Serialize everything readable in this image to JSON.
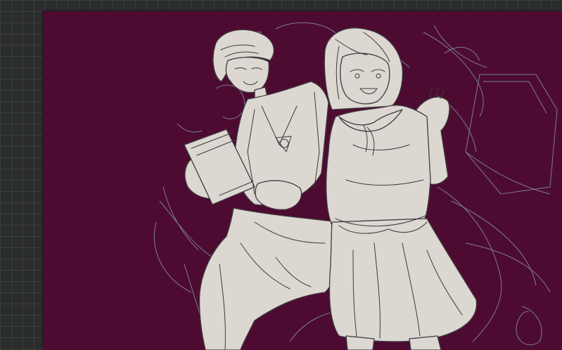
{
  "app": {
    "name": "drawing-canvas"
  },
  "colors": {
    "workspace_bg": "#2a2d2c",
    "grid_line": "#3a3e3c",
    "canvas_bg": "#4e0b31",
    "fill_flat": "#dcd7d1",
    "line_art": "#3d3a3f",
    "rough_sketch": "#7d8aa6"
  },
  "canvas": {
    "artwork": "two-character-sketch",
    "layers": [
      {
        "name": "flat-color"
      },
      {
        "name": "line-art"
      },
      {
        "name": "rough-sketch"
      }
    ]
  }
}
